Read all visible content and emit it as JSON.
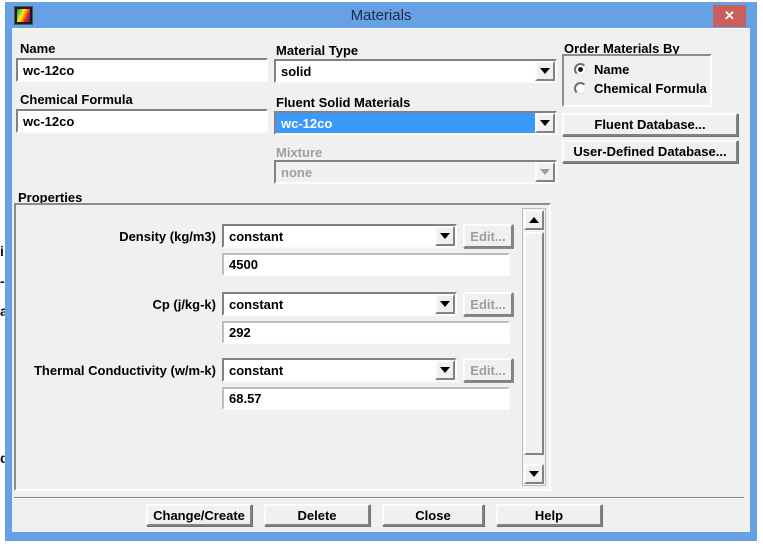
{
  "window": {
    "title": "Materials",
    "close_glyph": "✕"
  },
  "backdrop": {
    "fragments": [
      {
        "char": "i"
      },
      {
        "char": "-"
      },
      {
        "char": "a"
      },
      {
        "char": "d"
      }
    ]
  },
  "fields": {
    "name": {
      "label": "Name",
      "value": "wc-12co"
    },
    "chemical_formula": {
      "label": "Chemical Formula",
      "value": "wc-12co"
    },
    "material_type": {
      "label": "Material Type",
      "value": "solid"
    },
    "fluent_solid_materials": {
      "label": "Fluent Solid Materials",
      "value": "wc-12co"
    },
    "mixture": {
      "label": "Mixture",
      "value": "none"
    }
  },
  "order_materials_by": {
    "label": "Order Materials By",
    "options": [
      {
        "label": "Name",
        "selected": true
      },
      {
        "label": "Chemical Formula",
        "selected": false
      }
    ]
  },
  "properties": {
    "label": "Properties",
    "rows": [
      {
        "label": "Density (kg/m3)",
        "method": "constant",
        "value": "4500"
      },
      {
        "label": "Cp (j/kg-k)",
        "method": "constant",
        "value": "292"
      },
      {
        "label": "Thermal Conductivity (w/m-k)",
        "method": "constant",
        "value": "68.57"
      }
    ]
  },
  "buttons": {
    "fluent_database": "Fluent Database...",
    "user_defined_database": "User-Defined Database...",
    "edit": "Edit...",
    "change_create": "Change/Create",
    "delete": "Delete",
    "close": "Close",
    "help": "Help"
  },
  "colors": {
    "frame_blue": "#67A1E5",
    "dialog_gray": "#F0F0F0",
    "selection_blue": "#3B99FC",
    "close_red": "#C9605B",
    "disabled_text": "#9e9e9e"
  }
}
